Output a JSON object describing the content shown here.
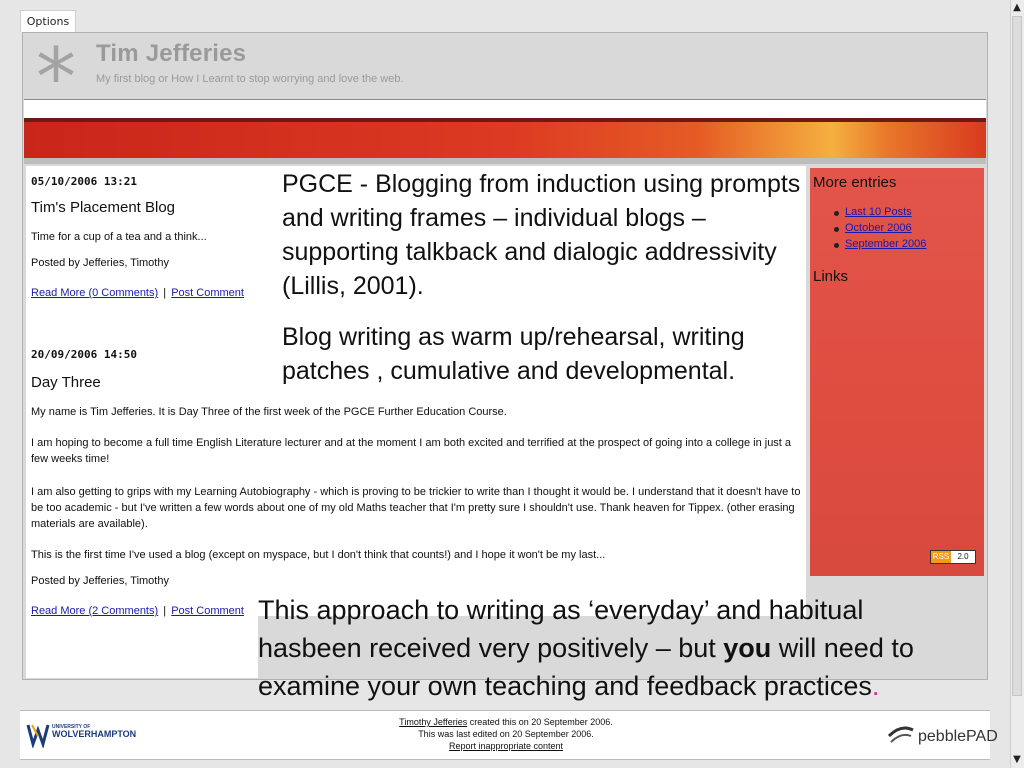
{
  "options_tab": "Options",
  "blog": {
    "title": "Tim Jefferies",
    "tagline": "My first blog or How I Learnt to stop worrying and love the web."
  },
  "posts": [
    {
      "date": "05/10/2006 13:21",
      "title": "Tim's Placement Blog",
      "paragraphs": [
        "Time for a cup of a tea and a think..."
      ],
      "posted_by": "Posted by Jefferies, Timothy",
      "read_more": "Read More (0 Comments)",
      "separator": "|",
      "post_comment": "Post Comment"
    },
    {
      "date": "20/09/2006 14:50",
      "title": "Day Three",
      "paragraphs": [
        "My name is Tim Jefferies. It is Day Three of the first week of the PGCE Further Education Course.",
        "I am hoping to become a full time English Literature lecturer and at the moment I am both excited and terrified at the prospect of going into a college in just a few weeks time!",
        "I am also getting to grips with my Learning Autobiography - which is proving to be trickier to write than I thought it would be. I understand that it doesn't have to be too academic - but I've written a few words about one of my old Maths teacher that I'm pretty sure I shouldn't use. Thank heaven for Tippex. (other erasing materials are available).",
        "This is the first time I've used a blog (except on myspace, but I don't think that counts!) and I hope it won't be my last..."
      ],
      "posted_by": "Posted by Jefferies, Timothy",
      "read_more": "Read More (2 Comments)",
      "separator": "|",
      "post_comment": "Post Comment"
    }
  ],
  "sidebar": {
    "more_entries": "More entries",
    "links": [
      "Last 10 Posts",
      "October 2006",
      "September 2006"
    ],
    "links_heading": "Links",
    "rss_a": "RSS",
    "rss_b": "2.0"
  },
  "overlay": {
    "text1": "PGCE - Blogging from induction using prompts and writing frames – individual blogs – supporting talkback  and dialogic addressivity (Lillis, 2001).",
    "text2": "Blog writing as warm up/rehearsal, writing patches , cumulative and developmental.",
    "text3_a": "This approach to writing as ‘everyday’ and habitual hasbeen received  very positively – but ",
    "text3_b": "you",
    "text3_c": " will need to examine your own teaching and feedback practices",
    "text3_d": "."
  },
  "footer": {
    "author_link": "Timothy Jefferies",
    "created": " created this on 20 September 2006.",
    "edited": "This was last edited on 20 September 2006.",
    "report": "Report inappropriate content",
    "uni_line1": "UNIVERSITY OF",
    "uni_line2": "WOLVERHAMPTON",
    "pebble": "pebblePAD"
  },
  "colors": {
    "banner": "#dc3a22",
    "sidebar": "#e2554a",
    "link": "#1a1aa8",
    "accent_dot": "#e0289a"
  }
}
